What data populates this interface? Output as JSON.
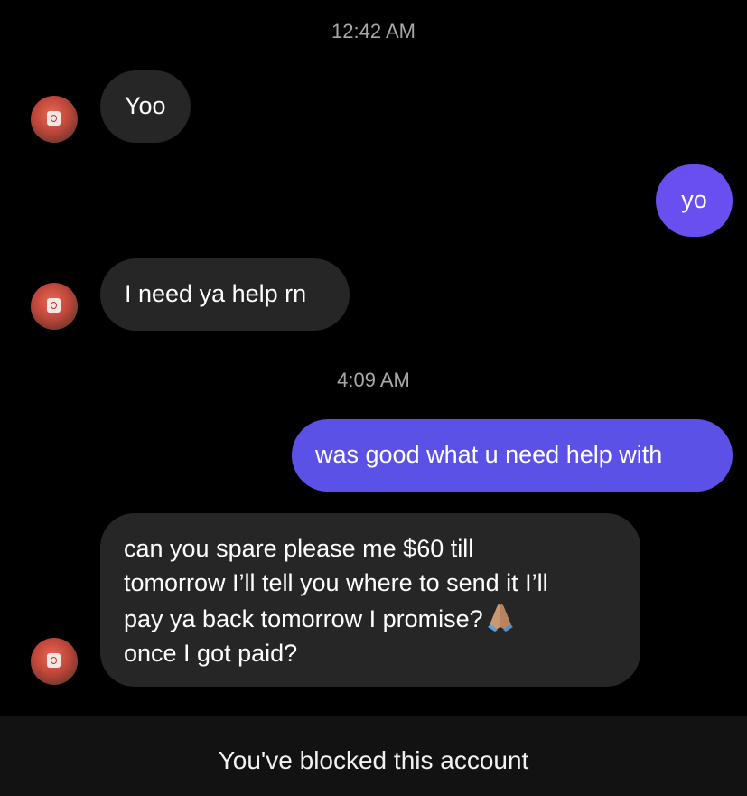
{
  "thread": {
    "timestamps": [
      "12:42 AM",
      "4:09 AM"
    ],
    "messages": [
      {
        "sender": "them",
        "text": "Yoo"
      },
      {
        "sender": "me",
        "text": "yo"
      },
      {
        "sender": "them",
        "text": "I need ya help rn"
      },
      {
        "sender": "me",
        "text": "was good what u need help with"
      },
      {
        "sender": "them",
        "lines": [
          "can you spare please me $60 till",
          "tomorrow I’ll tell you where to send it I’ll",
          "pay ya back tomorrow I promise?",
          "once I got paid?"
        ],
        "emoji": "praying-hands-icon"
      }
    ]
  },
  "footer": {
    "blocked_text": "You've blocked this account"
  },
  "colors": {
    "background": "#000000",
    "incoming_bubble": "#262626",
    "outgoing_bubble": "#6a4ff0",
    "timestamp": "#a8a8a8",
    "footer_bar": "#121212"
  }
}
